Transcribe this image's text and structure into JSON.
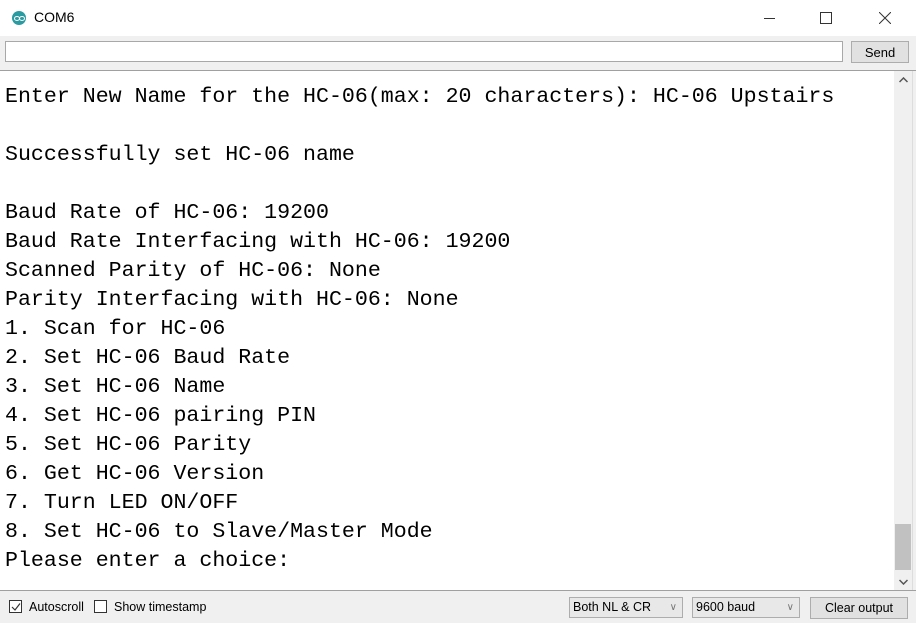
{
  "window": {
    "title": "COM6",
    "controls": {
      "minimize": "minimize",
      "maximize": "maximize",
      "close": "close"
    }
  },
  "send_bar": {
    "input_value": "",
    "send_label": "Send"
  },
  "output": {
    "lines": [
      "",
      "Enter New Name for the HC-06(max: 20 characters): HC-06 Upstairs",
      "",
      "Successfully set HC-06 name",
      "",
      "Baud Rate of HC-06: 19200",
      "Baud Rate Interfacing with HC-06: 19200",
      "Scanned Parity of HC-06: None",
      "Parity Interfacing with HC-06: None",
      "1. Scan for HC-06",
      "2. Set HC-06 Baud Rate",
      "3. Set HC-06 Name",
      "4. Set HC-06 pairing PIN",
      "5. Set HC-06 Parity",
      "6. Get HC-06 Version",
      "7. Turn LED ON/OFF",
      "8. Set HC-06 to Slave/Master Mode",
      "Please enter a choice:"
    ]
  },
  "status_bar": {
    "autoscroll_label": "Autoscroll",
    "autoscroll_checked": true,
    "timestamp_label": "Show timestamp",
    "timestamp_checked": false,
    "line_ending": "Both NL & CR",
    "baud_rate": "9600 baud",
    "clear_label": "Clear output"
  },
  "colors": {
    "app_icon": "#2a9ba1",
    "chrome": "#f0f0f0"
  }
}
